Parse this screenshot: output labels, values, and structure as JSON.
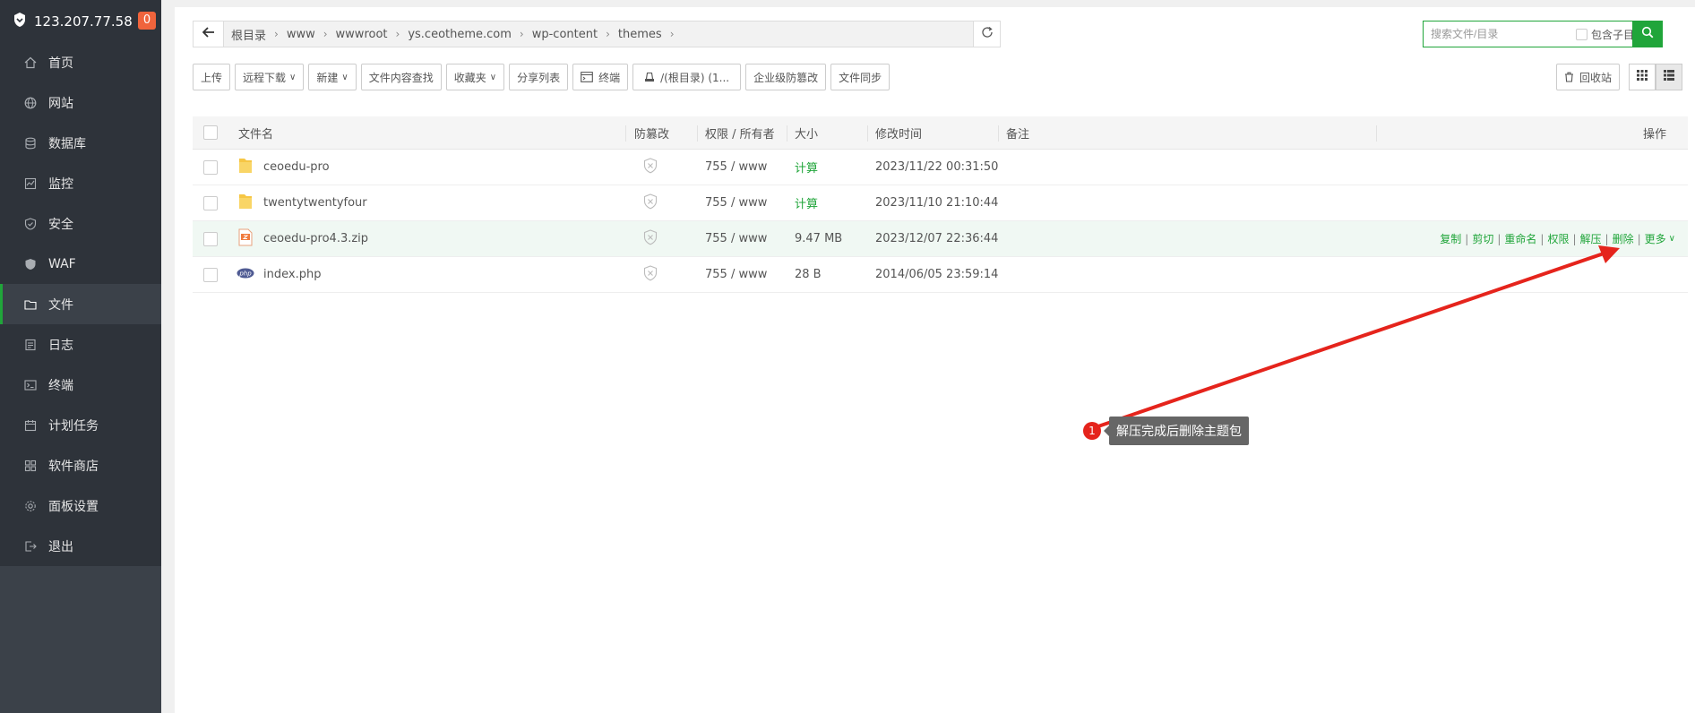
{
  "server": {
    "ip": "123.207.77.58",
    "badge": "0"
  },
  "sidebar": {
    "items": [
      {
        "label": "首页",
        "icon": "home-icon"
      },
      {
        "label": "网站",
        "icon": "globe-icon"
      },
      {
        "label": "数据库",
        "icon": "database-icon"
      },
      {
        "label": "监控",
        "icon": "monitor-icon"
      },
      {
        "label": "安全",
        "icon": "shield-icon"
      },
      {
        "label": "WAF",
        "icon": "waf-icon"
      },
      {
        "label": "文件",
        "icon": "folder-icon",
        "active": true
      },
      {
        "label": "日志",
        "icon": "log-icon"
      },
      {
        "label": "终端",
        "icon": "terminal-icon"
      },
      {
        "label": "计划任务",
        "icon": "calendar-icon"
      },
      {
        "label": "软件商店",
        "icon": "apps-icon"
      },
      {
        "label": "面板设置",
        "icon": "gear-icon"
      },
      {
        "label": "退出",
        "icon": "logout-icon"
      }
    ]
  },
  "breadcrumb": [
    "根目录",
    "www",
    "wwwroot",
    "ys.ceotheme.com",
    "wp-content",
    "themes"
  ],
  "search": {
    "placeholder": "搜索文件/目录",
    "subdir_label": "包含子目录"
  },
  "toolbar": {
    "upload": "上传",
    "remote_download": "远程下载",
    "new": "新建",
    "content_search": "文件内容查找",
    "favorites": "收藏夹",
    "share_list": "分享列表",
    "terminal": "终端",
    "disk": "/(根目录) (1...",
    "tamper_proof": "企业级防篡改",
    "file_sync": "文件同步",
    "recycle_bin": "回收站"
  },
  "table": {
    "headers": {
      "name": "文件名",
      "tamper": "防篡改",
      "perm": "权限 / 所有者",
      "size": "大小",
      "mtime": "修改时间",
      "note": "备注",
      "ops": "操作"
    },
    "rows": [
      {
        "name": "ceoedu-pro",
        "type": "folder",
        "perm": "755 / www",
        "size": "计算",
        "mtime": "2023/11/22 00:31:50"
      },
      {
        "name": "twentytwentyfour",
        "type": "folder",
        "perm": "755 / www",
        "size": "计算",
        "mtime": "2023/11/10 21:10:44"
      },
      {
        "name": "ceoedu-pro4.3.zip",
        "type": "zip",
        "perm": "755 / www",
        "size": "9.47 MB",
        "mtime": "2023/12/07 22:36:44"
      },
      {
        "name": "index.php",
        "type": "php",
        "perm": "755 / www",
        "size": "28 B",
        "mtime": "2014/06/05 23:59:14"
      }
    ],
    "row_actions": [
      "复制",
      "剪切",
      "重命名",
      "权限",
      "解压",
      "删除",
      "更多"
    ]
  },
  "annotation": {
    "number": "1",
    "text": "解压完成后删除主题包",
    "color": "#e5241c"
  },
  "colors": {
    "accent": "#20a53a",
    "sidebar": "#3b4149",
    "annotation": "#e5241c"
  }
}
